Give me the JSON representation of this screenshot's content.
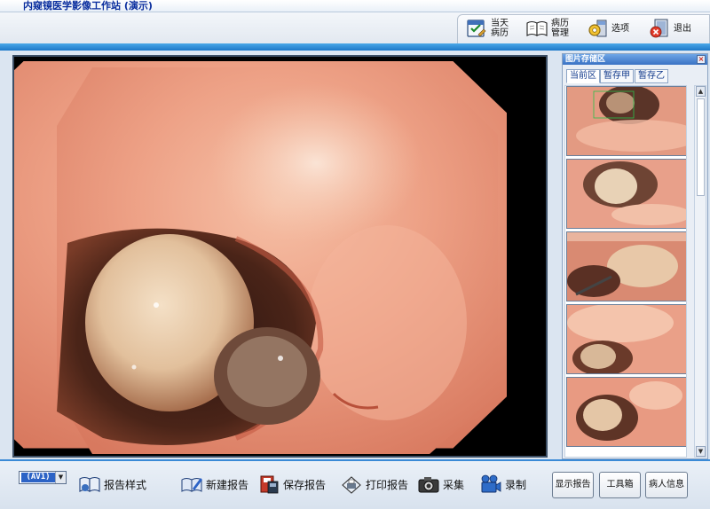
{
  "window": {
    "title": "内窥镜医学影像工作站 (演示)"
  },
  "toolbar": [
    {
      "id": "today",
      "label": "当天 病历",
      "icon": "calendar-icon"
    },
    {
      "id": "records",
      "label": "病历 管理",
      "icon": "book-icon"
    },
    {
      "id": "options",
      "label": "选项",
      "icon": "gear-icon"
    },
    {
      "id": "exit",
      "label": "退出",
      "icon": "exit-icon"
    }
  ],
  "image_store": {
    "title": "图片存储区",
    "tabs": [
      "当前区",
      "暂存甲",
      "暂存乙"
    ],
    "active_tab": "当前区",
    "thumbnail_count": 4
  },
  "bottom": {
    "channel": "(AV1)",
    "report_style": "报告样式",
    "actions": [
      {
        "id": "new-report",
        "label": "新建报告",
        "icon": "new-report-icon"
      },
      {
        "id": "save-report",
        "label": "保存报告",
        "icon": "save-report-icon"
      },
      {
        "id": "print-report",
        "label": "打印报告",
        "icon": "print-report-icon"
      },
      {
        "id": "capture",
        "label": "采集",
        "icon": "camera-icon"
      },
      {
        "id": "record",
        "label": "录制",
        "icon": "video-camera-icon"
      }
    ],
    "buttons": [
      "显示报告",
      "工具箱",
      "病人信息"
    ]
  },
  "colors": {
    "accent": "#2b7ad8",
    "title_text": "#0a2e9e",
    "tissue": "#e8927a",
    "frame": "#000000"
  }
}
